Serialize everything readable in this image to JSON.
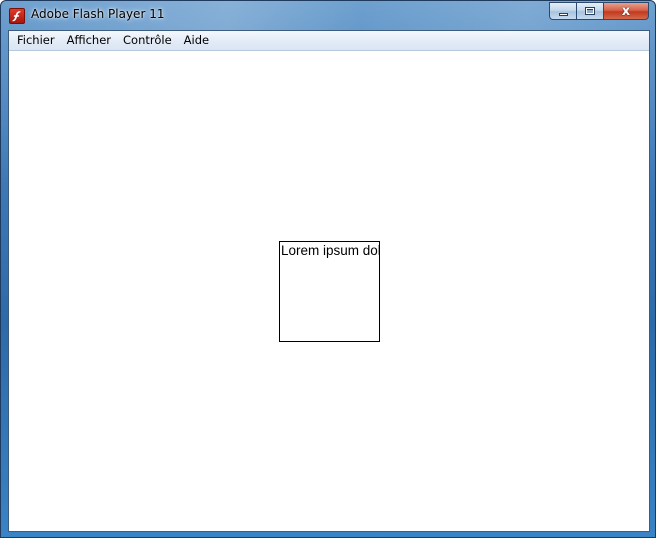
{
  "window": {
    "title": "Adobe Flash Player 11",
    "close_glyph": "x"
  },
  "menu": {
    "items": [
      {
        "label": "Fichier"
      },
      {
        "label": "Afficher"
      },
      {
        "label": "Contrôle"
      },
      {
        "label": "Aide"
      }
    ]
  },
  "stage": {
    "text_field": "Lorem ipsum dolor sit amet"
  },
  "icons": {
    "app": "flash-player-icon",
    "minimize": "minimize-icon",
    "maximize": "maximize-icon",
    "close": "close-icon"
  },
  "colors": {
    "titlebar_blue": "#3d78b5",
    "close_red": "#c23a1e",
    "flash_red": "#c0201a",
    "menubar_bg": "#e1eaf6"
  }
}
